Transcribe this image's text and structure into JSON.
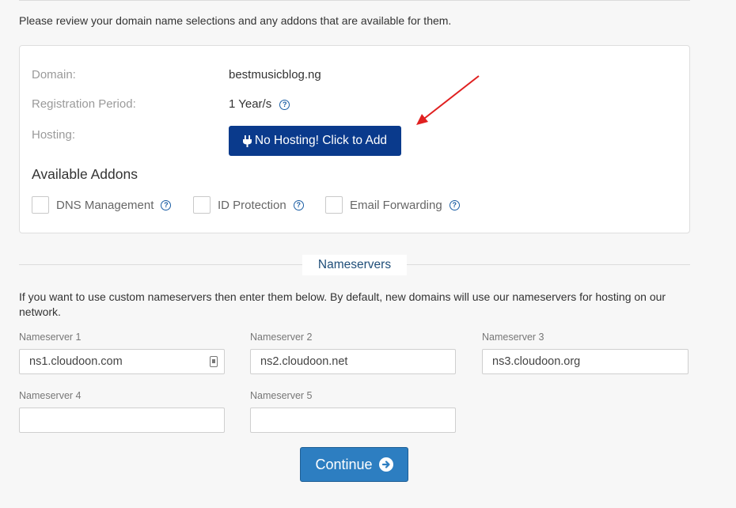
{
  "intro_text": "Please review your domain name selections and any addons that are available for them.",
  "domain_card": {
    "domain_label": "Domain:",
    "domain_value": "bestmusicblog.ng",
    "period_label": "Registration Period:",
    "period_value": "1 Year/s",
    "hosting_label": "Hosting:",
    "hosting_button": "No Hosting! Click to Add",
    "addons_title": "Available Addons",
    "addons": [
      {
        "label": "DNS Management"
      },
      {
        "label": "ID Protection"
      },
      {
        "label": "Email Forwarding"
      }
    ]
  },
  "nameservers": {
    "title": "Nameservers",
    "description": "If you want to use custom nameservers then enter them below. By default, new domains will use our nameservers for hosting on our network.",
    "fields": [
      {
        "label": "Nameserver 1",
        "value": "ns1.cloudoon.com"
      },
      {
        "label": "Nameserver 2",
        "value": "ns2.cloudoon.net"
      },
      {
        "label": "Nameserver 3",
        "value": "ns3.cloudoon.org"
      },
      {
        "label": "Nameserver 4",
        "value": ""
      },
      {
        "label": "Nameserver 5",
        "value": ""
      }
    ]
  },
  "continue_button": "Continue",
  "colors": {
    "primary_dark": "#0a3a8c",
    "primary": "#2d7ec1",
    "annotation_arrow": "#e02020"
  },
  "icons": {
    "hosting": "plug-icon",
    "help": "question-circle-icon",
    "continue": "arrow-circle-right-icon",
    "field_autofill": "contact-card-icon"
  }
}
